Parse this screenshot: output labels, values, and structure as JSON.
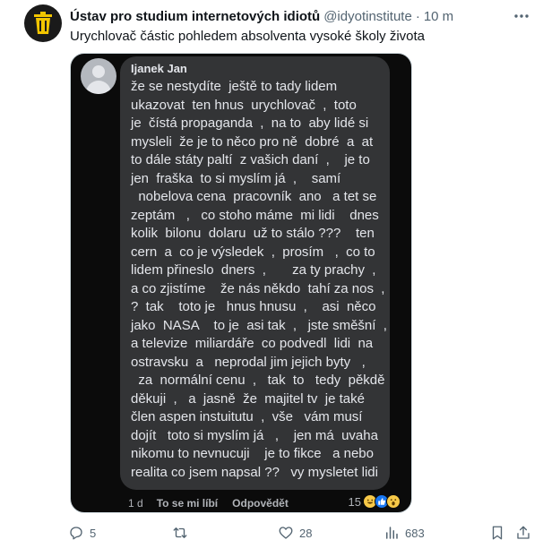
{
  "post": {
    "author_name": "Ústav pro studium internetových idiotů",
    "author_handle": "@idyotinstitute",
    "separator": "·",
    "time": "10 m",
    "text": "Urychlovač částic pohledem absolventa vysoké školy života"
  },
  "screenshot": {
    "commenter_name": "Ijanek Jan",
    "comment_lines": [
      "že se nestydíte  ještě to tady lidem",
      "ukazovat  ten hnus  urychlovač  ,  toto",
      "je  čístá propaganda  ,  na to  aby lidé si",
      "mysleli  že je to něco pro ně  dobré  a  at",
      "to dále státy paltí  z vašich daní  ,    je to",
      "jen  fraška  to si myslím já  ,    samí",
      "  nobelova cena  pracovník  ano   a tet se",
      "zeptám   ,   co stoho máme  mi lidi    dnes",
      "kolik  bilonu  dolaru  už to stálo ???    ten",
      "cern  a  co je výsledek  ,  prosím   ,  co to",
      "lidem přineslo  dners  ,       za ty prachy  ,",
      "a co zjistíme    že nás někdo  tahí za nos  ,",
      "?  tak    toto je   hnus hnusu  ,    asi  něco",
      "jako  NASA    to je  asi tak  ,   jste směšní  ,",
      "a televize  miliardáře  co podvedl  lidi  na",
      "ostravsku  a   neprodal jim jejich byty   ,",
      "  za  normální cenu  ,   tak  to   tedy  pěkdě",
      "děkuji  ,   a  jasně  že  majitel tv  je také",
      "člen aspen instuitutu  ,  vše   vám musí",
      "dojít   toto si myslím já   ,    jen má  uvaha",
      "nikomu to nevnucuji    je to fikce   a nebo",
      "realita co jsem napsal ??   vy mysletet lidi"
    ],
    "comment_time": "1 d",
    "like_label": "To se mi líbí",
    "reply_label": "Odpovědět",
    "reaction_count": "15"
  },
  "engagement": {
    "replies": "5",
    "retweets": "",
    "likes": "28",
    "views": "683"
  },
  "colors": {
    "text_primary": "#0f1419",
    "text_secondary": "#536471",
    "bubble_bg": "#333436",
    "bubble_text": "#e4e6eb",
    "fb_like_blue": "#1877f2"
  }
}
